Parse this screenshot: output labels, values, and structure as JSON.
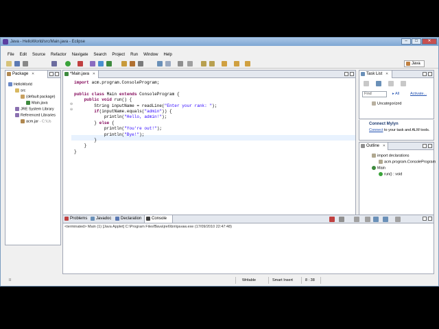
{
  "window": {
    "title": "Java - HelloWorld/src/Main.java - Eclipse"
  },
  "menu": [
    "File",
    "Edit",
    "Source",
    "Refactor",
    "Navigate",
    "Search",
    "Project",
    "Run",
    "Window",
    "Help"
  ],
  "perspective": {
    "label": "Java"
  },
  "package_explorer": {
    "tab_label": "Package",
    "items": [
      {
        "label": "HelloWorld",
        "level": 0
      },
      {
        "label": "src",
        "level": 1
      },
      {
        "label": "(default package)",
        "level": 2
      },
      {
        "label": "Main.java",
        "level": 3
      },
      {
        "label": "JRE System Library",
        "level": 1
      },
      {
        "label": "Referenced Libraries",
        "level": 1
      },
      {
        "label": "acm.jar",
        "hint": "- C:\\Us",
        "level": 2
      }
    ]
  },
  "editor": {
    "tab_label": "*Main.java",
    "lines": [
      [
        [
          "kw",
          "import"
        ],
        [
          "txt",
          " acm.program.ConsoleProgram;"
        ]
      ],
      [],
      [
        [
          "kw",
          "public"
        ],
        [
          "txt",
          " "
        ],
        [
          "kw",
          "class"
        ],
        [
          "txt",
          " Main "
        ],
        [
          "kw",
          "extends"
        ],
        [
          "txt",
          " ConsoleProgram {"
        ]
      ],
      [
        [
          "txt",
          "    "
        ],
        [
          "kw",
          "public"
        ],
        [
          "txt",
          " "
        ],
        [
          "kw",
          "void"
        ],
        [
          "txt",
          " run() {"
        ]
      ],
      [
        [
          "txt",
          "        String inputName = readLine("
        ],
        [
          "str",
          "\"Enter your rank: \""
        ],
        [
          "txt",
          ");"
        ]
      ],
      [
        [
          "txt",
          "        "
        ],
        [
          "kw",
          "if"
        ],
        [
          "txt",
          "(inputName.equals("
        ],
        [
          "str",
          "\"admin\""
        ],
        [
          "txt",
          ")) {"
        ]
      ],
      [
        [
          "txt",
          "            println("
        ],
        [
          "str",
          "\"Hello, admin!\""
        ],
        [
          "txt",
          ");"
        ]
      ],
      [
        [
          "txt",
          "        } "
        ],
        [
          "kw",
          "else"
        ],
        [
          "txt",
          " {"
        ]
      ],
      [
        [
          "txt",
          "            println("
        ],
        [
          "str",
          "\"You're out!\""
        ],
        [
          "txt",
          ");"
        ]
      ],
      [
        [
          "txt",
          "            println("
        ],
        [
          "str",
          "\"Bye!\""
        ],
        [
          "txt",
          ");"
        ]
      ],
      [
        [
          "txt",
          "        }"
        ]
      ],
      [
        [
          "txt",
          "    }"
        ]
      ],
      [
        [
          "txt",
          "}"
        ]
      ]
    ]
  },
  "task_list": {
    "tab_label": "Task List",
    "find_placeholder": "Find",
    "all_label": "All",
    "activate_label": "Activate...",
    "item": "Uncategorized"
  },
  "mylyn": {
    "heading": "Connect Mylyn",
    "link_text": "Connect",
    "rest_text": "to your task and ALM tools."
  },
  "outline": {
    "tab_label": "Outline",
    "items": [
      {
        "label": "import declarations",
        "level": 0
      },
      {
        "label": "acm.program.ConsoleProgram",
        "level": 1
      },
      {
        "label": "Main",
        "level": 0
      },
      {
        "label": "run() : void",
        "level": 1
      }
    ]
  },
  "bottom_tabs": [
    {
      "label": "Problems"
    },
    {
      "label": "Javadoc"
    },
    {
      "label": "Declaration"
    },
    {
      "label": "Console",
      "active": true
    }
  ],
  "console": {
    "status_text": "<terminated> Main (1) [Java Applet] C:\\Program Files\\Java\\jre6\\bin\\javaw.exe (17/09/2010 22:47:48)"
  },
  "status_bar": {
    "mode": "Writable",
    "insert": "Smart Insert",
    "position": "8 : 38"
  },
  "colors": {
    "keyword": "#7f0055",
    "string": "#2a00ff",
    "title_gradient": "#7ea6d3"
  }
}
